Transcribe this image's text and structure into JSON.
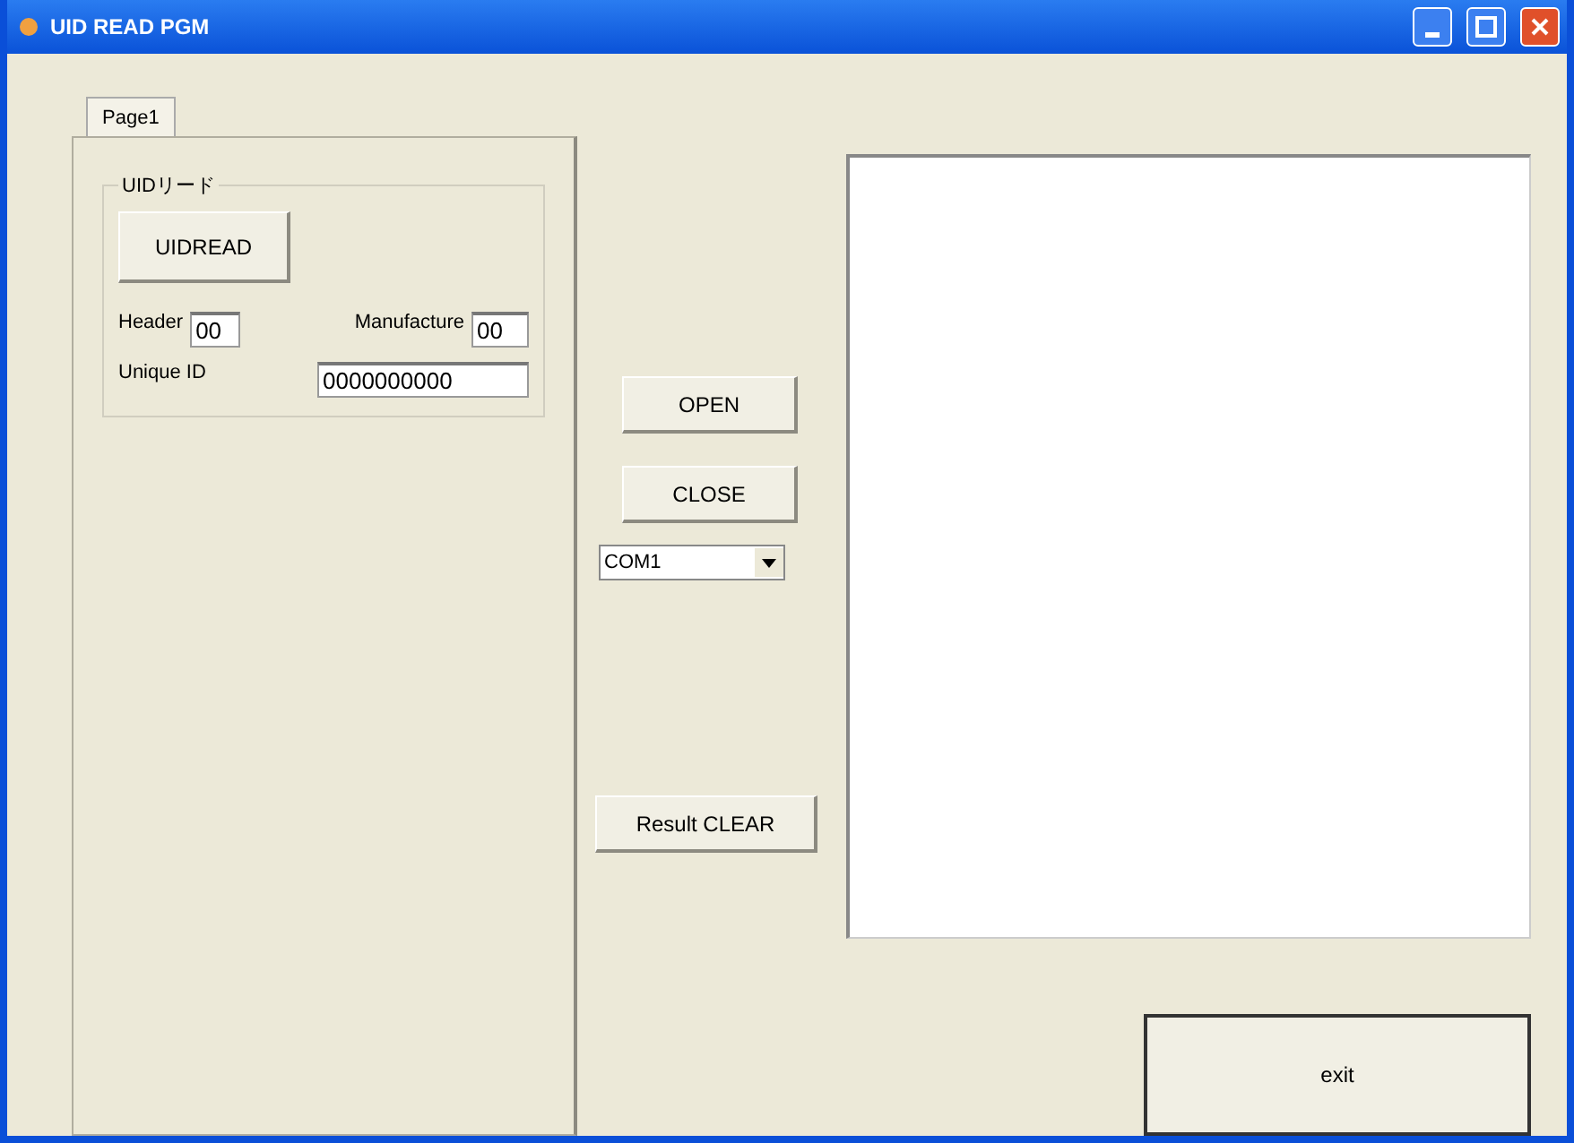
{
  "window": {
    "title": "UID READ PGM"
  },
  "tabs": [
    {
      "label": "Page1",
      "selected": true
    }
  ],
  "group": {
    "title": "UIDリード",
    "read_button": "UIDREAD",
    "header_label": "Header",
    "header_value": "00",
    "manufacture_label": "Manufacture",
    "manufacture_value": "00",
    "unique_label": "Unique ID",
    "unique_value": "0000000000"
  },
  "buttons": {
    "open": "OPEN",
    "close": "CLOSE",
    "clear": "Result CLEAR",
    "exit": "exit"
  },
  "port": {
    "value": "COM1"
  }
}
